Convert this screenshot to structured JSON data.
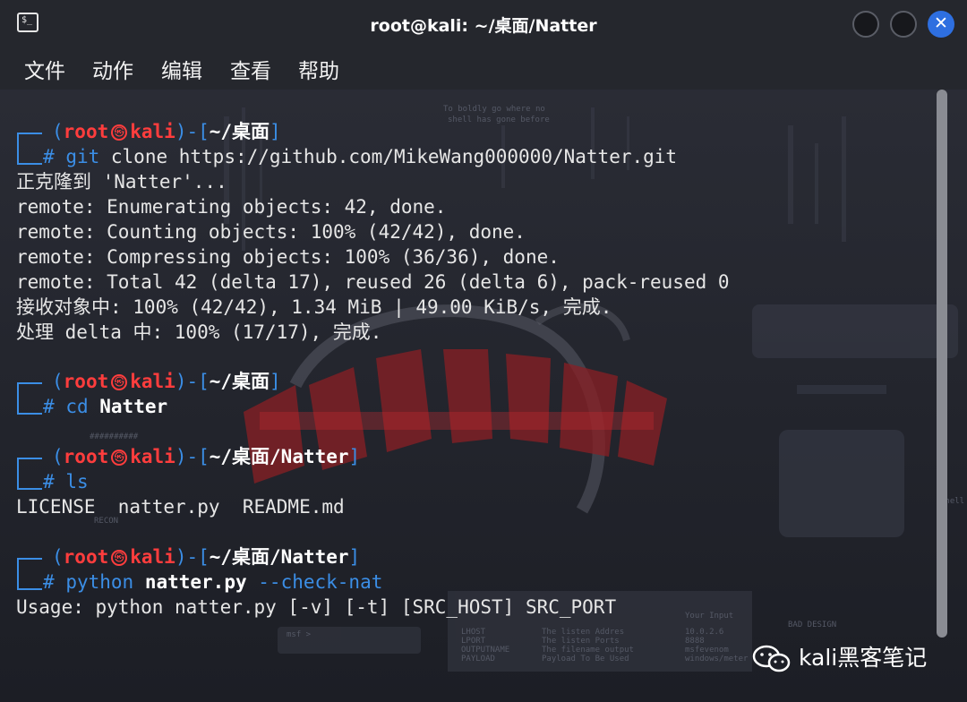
{
  "window": {
    "title": "root@kali: ~/桌面/Natter",
    "close_glyph": "✕",
    "terminal_glyph": "$_"
  },
  "menu": {
    "items": [
      "文件",
      "动作",
      "编辑",
      "查看",
      "帮助"
    ]
  },
  "prompt": {
    "open": "(",
    "user": "root",
    "host": "kali",
    "close_join": ")-[",
    "symbol": "#",
    "skull": "㉿"
  },
  "terminal": {
    "blocks": [
      {
        "path": "~/桌面",
        "command": "git",
        "args": " clone https://github.com/MikeWang000000/Natter.git",
        "output": [
          "正克隆到 'Natter'...",
          "remote: Enumerating objects: 42, done.",
          "remote: Counting objects: 100% (42/42), done.",
          "remote: Compressing objects: 100% (36/36), done.",
          "remote: Total 42 (delta 17), reused 26 (delta 6), pack-reused 0",
          "接收对象中: 100% (42/42), 1.34 MiB | 49.00 KiB/s, 完成.",
          "处理 delta 中: 100% (17/17), 完成."
        ]
      },
      {
        "path": "~/桌面",
        "command": "cd",
        "args_bold": "Natter",
        "output": []
      },
      {
        "path": "~/桌面/Natter",
        "command": "ls",
        "output": [
          "LICENSE  natter.py  README.md"
        ]
      },
      {
        "path": "~/桌面/Natter",
        "command": "python",
        "args_bold": "natter.py",
        "flag": "--check-nat",
        "output": [
          "Usage: python natter.py [-v] [-t] [SRC_HOST] SRC_PORT"
        ]
      }
    ]
  },
  "watermark": {
    "text": "kali黑客笔记"
  },
  "background_texts": [
    "To boldly go where no",
    "shell has gone before",
    "msf >",
    "LHOST",
    "LPORT",
    "OUTPUTNAME",
    "PAYLOAD",
    "The listen Addres",
    "The listen Ports",
    "The filename output",
    "Payload To Be Used",
    "Your Input",
    "10.0.2.6",
    "8888",
    "msfevenom",
    "windows/meter",
    "Shell",
    "RECON",
    "##########",
    "BAD DESIGN"
  ],
  "colors": {
    "prompt_frame": "#3b8ee6",
    "prompt_user": "#ff3d3d",
    "text": "#e6e6e6",
    "close_button": "#2e6fe0"
  }
}
